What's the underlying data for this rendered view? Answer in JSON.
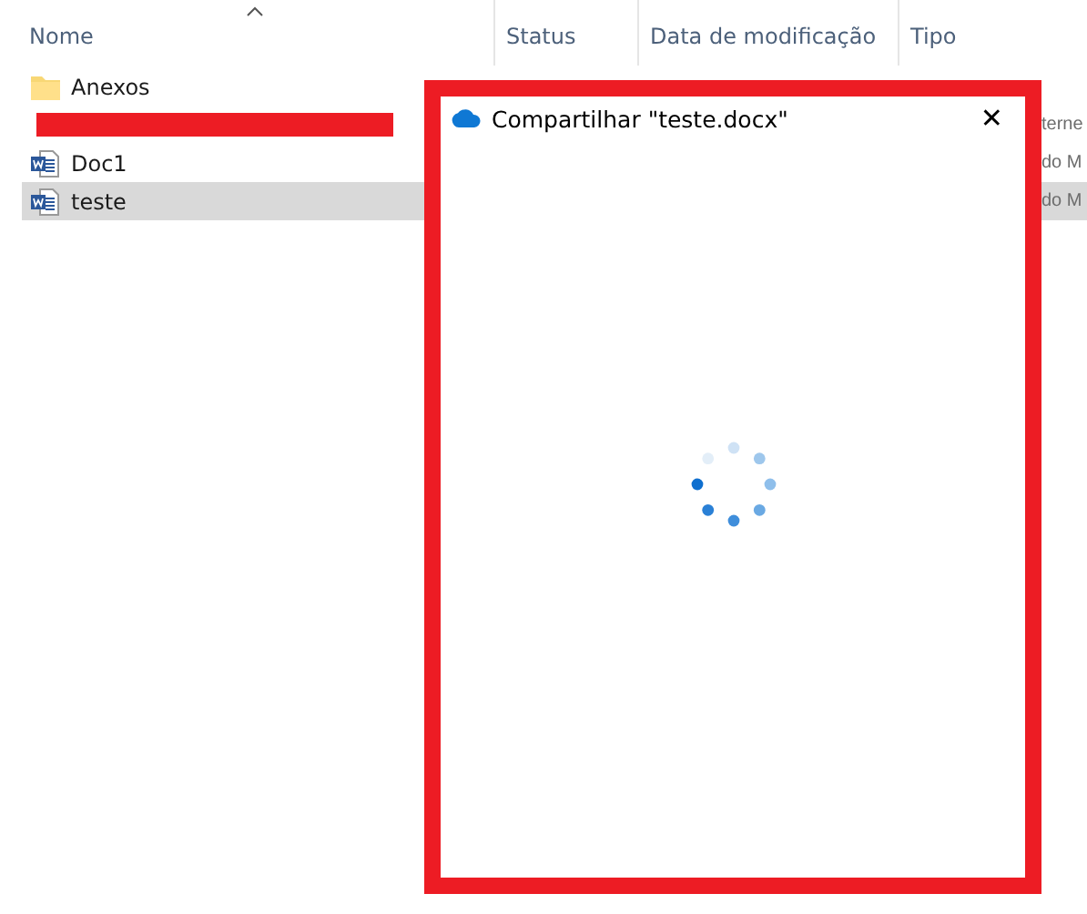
{
  "explorer": {
    "columns": [
      "Nome",
      "Status",
      "Data de modificação",
      "Tipo"
    ],
    "rows": [
      {
        "kind": "folder",
        "name": "Anexos",
        "selected": false
      },
      {
        "kind": "redacted",
        "type": "terne",
        "selected": false
      },
      {
        "kind": "word",
        "name": "Doc1",
        "type": "do M",
        "selected": false
      },
      {
        "kind": "word",
        "name": "teste",
        "type": "do M",
        "selected": true
      }
    ]
  },
  "dialog": {
    "title": "Compartilhar \"teste.docx\"",
    "close": "✕",
    "loading": true
  }
}
